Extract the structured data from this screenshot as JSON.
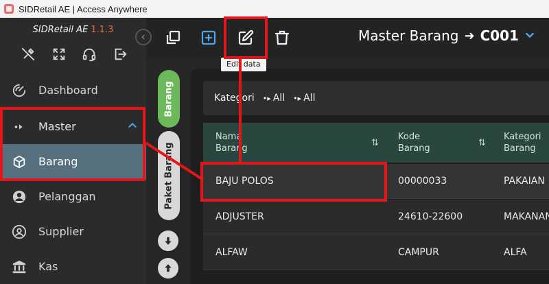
{
  "window": {
    "title": "SIDRetail AE | Access Anywhere"
  },
  "brand": {
    "name": "SIDRetail AE",
    "version": "1.1.3"
  },
  "quick_icons": [
    "tools-off-icon",
    "fullscreen-icon",
    "headset-icon",
    "logout-icon"
  ],
  "sidebar": {
    "items": [
      {
        "label": "Dashboard",
        "icon": "gauge-icon"
      },
      {
        "label": "Master",
        "icon": "dots-arrow-icon",
        "expanded": true
      },
      {
        "label": "Barang",
        "icon": "box-icon",
        "selected": true
      },
      {
        "label": "Pelanggan",
        "icon": "user-circle-icon"
      },
      {
        "label": "Supplier",
        "icon": "user-circle-outline-icon"
      },
      {
        "label": "Kas",
        "icon": "bank-icon"
      }
    ]
  },
  "toolbar": {
    "tooltip": "Edit data",
    "page_title": "Master Barang",
    "arrow": "➜",
    "code": "C001"
  },
  "tabs": {
    "barang": "Barang",
    "paket_barang": "Paket Barang"
  },
  "filter": {
    "label": "Kategori",
    "chips": [
      "All",
      "All"
    ]
  },
  "table": {
    "columns": [
      {
        "line1": "Nama",
        "line2": "Barang"
      },
      {
        "line1": "Kode",
        "line2": "Barang"
      },
      {
        "line1": "Kategori",
        "line2": "Barang"
      }
    ],
    "rows": [
      [
        "BAJU POLOS",
        "00000033",
        "PAKAIAN"
      ],
      [
        "ADJUSTER",
        "24610-22600",
        "MAKANAN"
      ],
      [
        "ALFAW",
        "CAMPUR",
        "ALFA"
      ]
    ]
  },
  "colors": {
    "accent_blue": "#4ea5e8",
    "tab_active": "#6cb85a",
    "selected_item": "#56707e",
    "table_header": "#29463f",
    "annotation_red": "#e3161c",
    "version": "#e06a45"
  }
}
